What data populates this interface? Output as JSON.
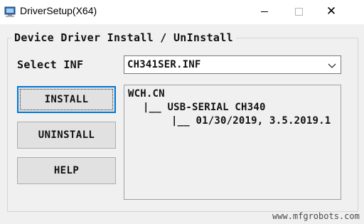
{
  "window": {
    "title": "DriverSetup(X64)",
    "icons": {
      "app": "computer-icon",
      "minimize": "minimize-icon",
      "maximize": "maximize-icon",
      "close": "close-icon"
    },
    "close_glyph": "✕"
  },
  "group": {
    "title": "Device Driver Install / UnInstall"
  },
  "select": {
    "label": "Select INF",
    "value": "CH341SER.INF",
    "arrow_icon": "chevron-down-icon"
  },
  "buttons": {
    "install": "INSTALL",
    "uninstall": "UNINSTALL",
    "help": "HELP"
  },
  "info": {
    "line1": "WCH.CN",
    "line2": "|__ USB-SERIAL CH340",
    "line3": "|__ 01/30/2019, 3.5.2019.1"
  },
  "watermark": "www.mfgrobots.com",
  "colors": {
    "focus_border": "#0078d7",
    "window_bg": "#f0f0f0",
    "button_bg": "#e1e1e1"
  }
}
